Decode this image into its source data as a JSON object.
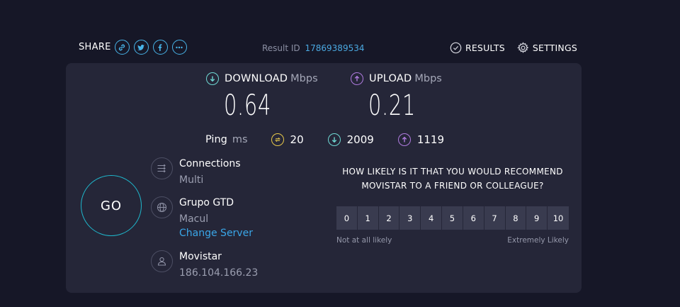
{
  "header": {
    "share_label": "SHARE",
    "share_icons": [
      "link-icon",
      "twitter-icon",
      "facebook-icon",
      "more-icon"
    ],
    "result_id_label": "Result ID",
    "result_id_value": "17869389534",
    "results_label": "RESULTS",
    "settings_label": "SETTINGS"
  },
  "download": {
    "label": "DOWNLOAD",
    "unit": "Mbps",
    "value": "0.64",
    "color": "#6fd9d4"
  },
  "upload": {
    "label": "UPLOAD",
    "unit": "Mbps",
    "value": "0.21",
    "color": "#b07be0"
  },
  "ping": {
    "label": "Ping",
    "unit": "ms",
    "idle": "20",
    "download": "2009",
    "upload": "1119",
    "idle_color": "#e8c94a"
  },
  "go_label": "GO",
  "connections": {
    "title": "Connections",
    "value": "Multi"
  },
  "server": {
    "title": "Grupo GTD",
    "location": "Macul",
    "change_label": "Change Server"
  },
  "isp": {
    "title": "Movistar",
    "ip": "186.104.166.23"
  },
  "survey": {
    "question_line1": "HOW LIKELY IS IT THAT YOU WOULD RECOMMEND",
    "question_line2": "MOVISTAR TO A FRIEND OR COLLEAGUE?",
    "scale": [
      "0",
      "1",
      "2",
      "3",
      "4",
      "5",
      "6",
      "7",
      "8",
      "9",
      "10"
    ],
    "low_label": "Not at all likely",
    "high_label": "Extremely Likely"
  },
  "colors": {
    "background": "#161727",
    "panel": "#252638",
    "accent_link": "#3aa6e8",
    "go_ring": "#1fb8cd"
  }
}
